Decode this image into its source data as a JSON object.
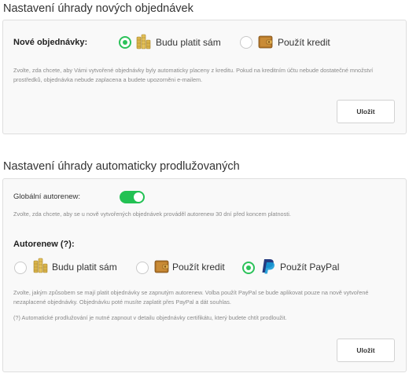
{
  "section1": {
    "title": "Nastavení úhrady nových objednávek",
    "field_label": "Nové objednávky:",
    "option_self": "Budu platit sám",
    "option_credit": "Použít kredit",
    "help": "Zvolte, zda chcete, aby Vámi vytvořené objednávky byly automaticky placeny z kreditu. Pokud na kreditním účtu nebude dostatečné množství prostředků, objednávka nebude zaplacena a budete upozorněni e-mailem.",
    "save_label": "Uložit",
    "selected": "self"
  },
  "section2": {
    "title": "Nastavení úhrady automaticky prodlužovaných",
    "global_label": "Globální autorenew:",
    "global_enabled": true,
    "global_help": "Zvolte, zda chcete, aby se u nově vytvořených objednávek prováděl autorenew 30 dní před koncem platnosti.",
    "autorenew_label": "Autorenew (?):",
    "option_self": "Budu platit sám",
    "option_credit": "Použít kredit",
    "option_paypal": "Použít PayPal",
    "selected": "paypal",
    "help1": "Zvolte, jakým způsobem se mají platit objednávky se zapnutým autorenew. Volba použít PayPal se bude aplikovat pouze na nově vytvořené nezaplacené objednávky. Objednávku poté musíte zaplatit přes PayPal a dát souhlas.",
    "help2": "(?) Automatické prodlužování je nutné zapnout v detailu objednávky certifikátu, který budete chtít prodloužit.",
    "save_label": "Uložit"
  },
  "colors": {
    "accent_green": "#2cc25a",
    "toggle_green": "#22c153",
    "paypal_dark": "#253b80",
    "paypal_light": "#179bd7"
  },
  "icons": [
    "coins-icon",
    "wallet-icon",
    "paypal-icon"
  ]
}
